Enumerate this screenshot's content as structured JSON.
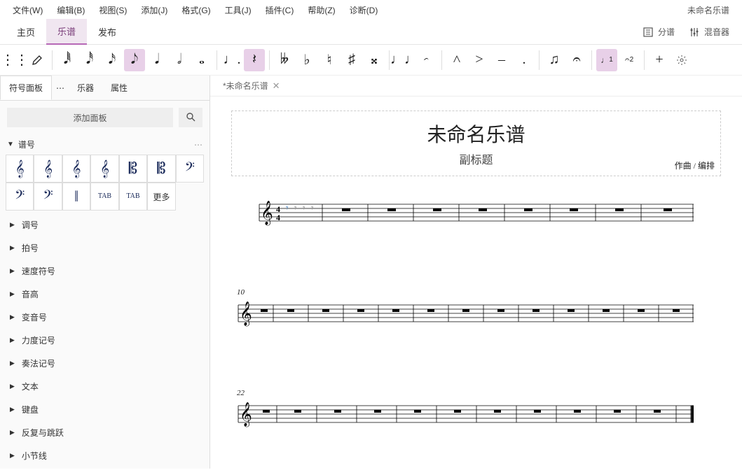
{
  "menu": {
    "items": [
      "文件(W)",
      "编辑(B)",
      "视图(S)",
      "添加(J)",
      "格式(G)",
      "工具(J)",
      "插件(C)",
      "帮助(Z)",
      "诊断(D)"
    ],
    "doc_title": "未命名乐谱"
  },
  "tabs": {
    "home": "主页",
    "score": "乐谱",
    "publish": "发布",
    "parts": "分谱",
    "mixer": "混音器"
  },
  "toolbar": {
    "notes": [
      "𝅘𝅥𝅱",
      "𝅘𝅥𝅰",
      "𝅘𝅥𝅯",
      "𝅘𝅥𝅮",
      "𝅘𝅥",
      "𝅗𝅥",
      "𝅝"
    ],
    "dot": "♩.",
    "rest": "𝄽",
    "accidentals": [
      "𝄫",
      "♭",
      "♮",
      "♯",
      "𝄪"
    ],
    "ties": [
      "♩♩",
      "𝆣"
    ],
    "articulations": [
      "˄",
      ">",
      "–",
      "."
    ],
    "tuplets": [
      "♫",
      "𝄐"
    ],
    "voice1": "1",
    "voice2": "2"
  },
  "sidebar": {
    "panel_tab": "符号面板",
    "instruments": "乐器",
    "properties": "属性",
    "add_panel": "添加面板",
    "clefs_section": "谱号",
    "clefs": [
      "𝄞",
      "𝄞",
      "𝄞",
      "𝄞",
      "𝄡",
      "𝄡",
      "𝄢",
      "𝄢",
      "𝄢",
      "‖",
      "TAB",
      "TAB"
    ],
    "more": "更多",
    "sections": [
      "调号",
      "拍号",
      "速度符号",
      "音高",
      "变音号",
      "力度记号",
      "奏法记号",
      "文本",
      "键盘",
      "反复与跳跃",
      "小节线"
    ]
  },
  "document": {
    "tab_name": "*未命名乐谱",
    "title": "未命名乐谱",
    "subtitle": "副标题",
    "composer": "作曲 / 编排",
    "measure2": "10",
    "measure3": "22"
  }
}
